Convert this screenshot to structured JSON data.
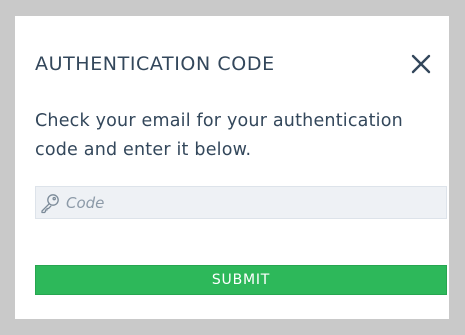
{
  "dialog": {
    "title": "AUTHENTICATION CODE",
    "close_icon": "close-x-icon",
    "message": "Check your email for your authentication code and enter it below.",
    "code_field": {
      "icon": "key-icon",
      "value": "",
      "placeholder": "Code"
    },
    "submit_label": "SUBMIT"
  },
  "colors": {
    "backdrop": "#c9c9c9",
    "text": "#33475b",
    "field_bg": "#eef1f5",
    "placeholder": "#8c9aa8",
    "submit_bg": "#2db85a"
  }
}
